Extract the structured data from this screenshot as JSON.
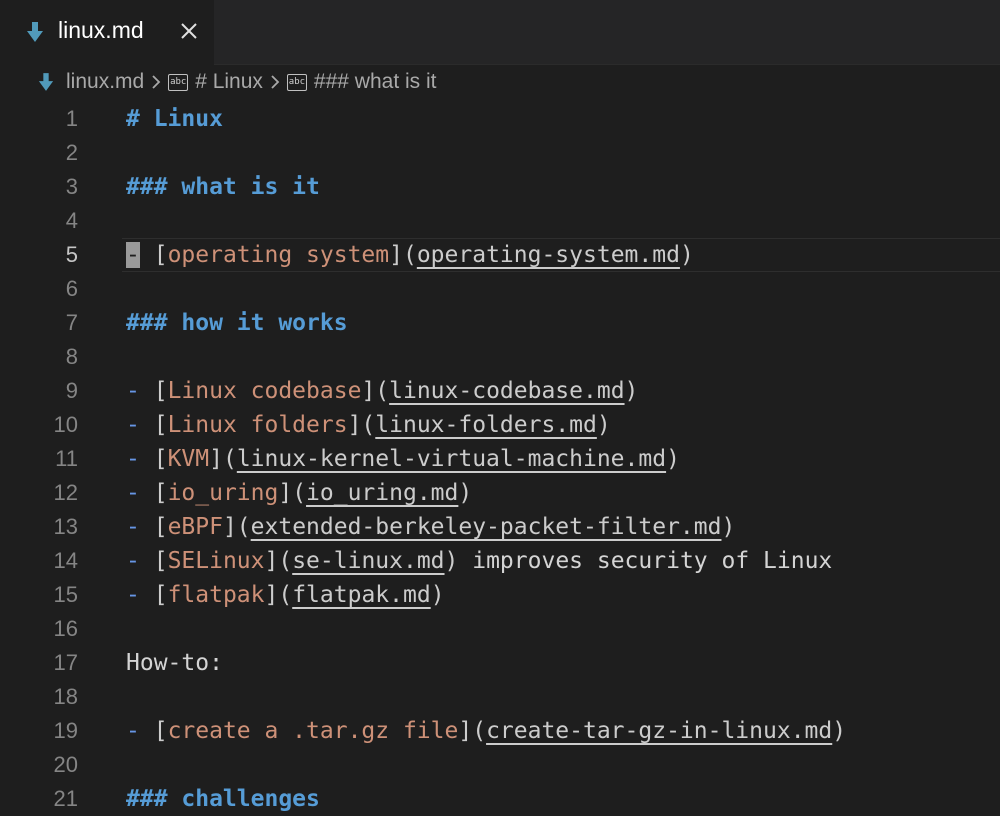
{
  "tab": {
    "label": "linux.md"
  },
  "breadcrumb": {
    "file": "linux.md",
    "h1": "# Linux",
    "h3": "### what is it"
  },
  "editor": {
    "current_line": 5,
    "lines": [
      {
        "n": "1",
        "kind": "h",
        "text": "# Linux"
      },
      {
        "n": "2",
        "kind": "blank"
      },
      {
        "n": "3",
        "kind": "h",
        "text": "### what is it"
      },
      {
        "n": "4",
        "kind": "blank"
      },
      {
        "n": "5",
        "kind": "link",
        "text": "operating system",
        "url": "operating-system.md",
        "cursor": true
      },
      {
        "n": "6",
        "kind": "blank"
      },
      {
        "n": "7",
        "kind": "h",
        "text": "### how it works"
      },
      {
        "n": "8",
        "kind": "blank"
      },
      {
        "n": "9",
        "kind": "link",
        "text": "Linux codebase",
        "url": "linux-codebase.md"
      },
      {
        "n": "10",
        "kind": "link",
        "text": "Linux folders",
        "url": "linux-folders.md"
      },
      {
        "n": "11",
        "kind": "link",
        "text": "KVM",
        "url": "linux-kernel-virtual-machine.md"
      },
      {
        "n": "12",
        "kind": "link",
        "text": "io_uring",
        "url": "io_uring.md"
      },
      {
        "n": "13",
        "kind": "link",
        "text": "eBPF",
        "url": "extended-berkeley-packet-filter.md"
      },
      {
        "n": "14",
        "kind": "link",
        "text": "SELinux",
        "url": "se-linux.md",
        "after": " improves security of Linux"
      },
      {
        "n": "15",
        "kind": "link",
        "text": "flatpak",
        "url": "flatpak.md"
      },
      {
        "n": "16",
        "kind": "blank"
      },
      {
        "n": "17",
        "kind": "plain",
        "text": "How-to:"
      },
      {
        "n": "18",
        "kind": "blank"
      },
      {
        "n": "19",
        "kind": "link",
        "text": "create a .tar.gz file",
        "url": "create-tar-gz-in-linux.md"
      },
      {
        "n": "20",
        "kind": "blank"
      },
      {
        "n": "21",
        "kind": "h",
        "text": "### challenges"
      }
    ]
  }
}
